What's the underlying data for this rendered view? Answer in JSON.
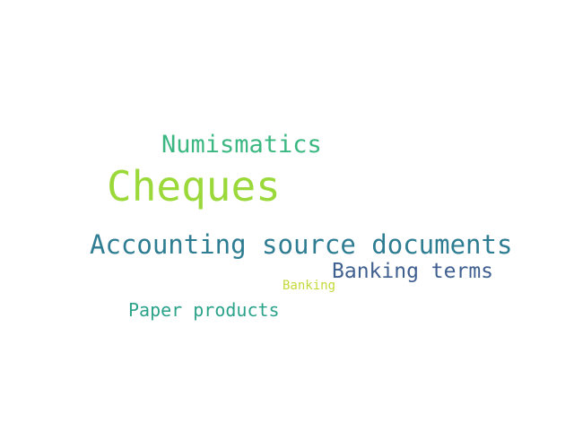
{
  "words": [
    {
      "text": "Numismatics",
      "color": "#3bb882"
    },
    {
      "text": "Cheques",
      "color": "#9bd93a"
    },
    {
      "text": "Accounting source documents",
      "color": "#2f7d92"
    },
    {
      "text": "Banking terms",
      "color": "#3f5f8f"
    },
    {
      "text": "Banking",
      "color": "#c4d93a"
    },
    {
      "text": "Paper products",
      "color": "#2ba38a"
    }
  ]
}
